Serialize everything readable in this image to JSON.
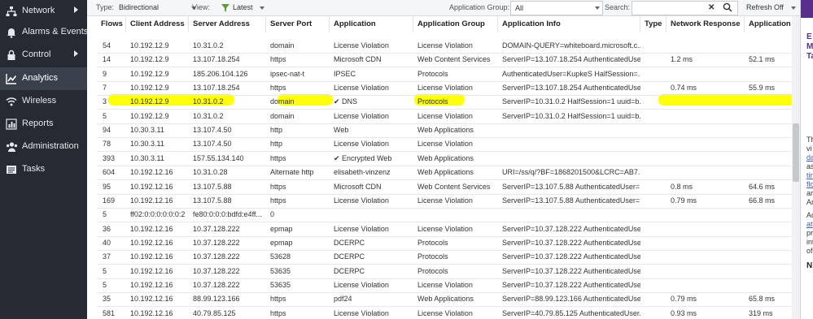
{
  "sidebar": {
    "items": [
      {
        "label": "Network",
        "icon": "network-icon",
        "has_chevron": true,
        "active": false
      },
      {
        "label": "Alarms & Events",
        "icon": "bell-icon",
        "has_chevron": false,
        "active": false
      },
      {
        "label": "Control",
        "icon": "lock-icon",
        "has_chevron": true,
        "active": false
      },
      {
        "label": "Analytics",
        "icon": "chart-line-icon",
        "has_chevron": false,
        "active": true
      },
      {
        "label": "Wireless",
        "icon": "wifi-icon",
        "has_chevron": false,
        "active": false
      },
      {
        "label": "Reports",
        "icon": "bar-chart-icon",
        "has_chevron": false,
        "active": false
      },
      {
        "label": "Administration",
        "icon": "users-icon",
        "has_chevron": false,
        "active": false
      },
      {
        "label": "Tasks",
        "icon": "tasks-icon",
        "has_chevron": false,
        "active": false
      }
    ]
  },
  "toolbar": {
    "type_label": "Type:",
    "type_value": "Bidirectional",
    "view_label": "View:",
    "view_value": "Latest",
    "app_group_label": "Application Group:",
    "app_group_value": "All",
    "search_label": "Search:",
    "search_value": "",
    "refresh_label": "Refresh Off"
  },
  "table": {
    "columns": [
      "Flows",
      "Client Address",
      "Server Address",
      "Server Port",
      "Application",
      "Application Group",
      "Application Info",
      "Type",
      "Network Response",
      "Application Resp"
    ],
    "partial_row": [
      "",
      "",
      "",
      "",
      "",
      "",
      "",
      "",
      "",
      ""
    ],
    "rows": [
      [
        "54",
        "10.192.12.9",
        "10.31.0.2",
        "domain",
        "License Violation",
        "License Violation",
        "DOMAIN-QUERY=whiteboard.microsoft.c...",
        "",
        "",
        ""
      ],
      [
        "14",
        "10.192.12.9",
        "13.107.18.254",
        "https",
        "Microsoft CDN",
        "Web Content Services",
        "ServerIP=13.107.18.254 AuthenticatedUse...",
        "",
        "1.2 ms",
        "52.1 ms"
      ],
      [
        "9",
        "10.192.12.9",
        "185.206.104.126",
        "ipsec-nat-t",
        "IPSEC",
        "Protocols",
        "AuthenticatedUser=KupkeS HalfSession=...",
        "",
        "",
        ""
      ],
      [
        "7",
        "10.192.12.9",
        "13.107.18.254",
        "https",
        "License Violation",
        "License Violation",
        "ServerIP=13.107.18.254 AuthenticatedUse...",
        "",
        "0.74 ms",
        "55.9 ms"
      ],
      [
        "3",
        "10.192.12.9",
        "10.31.0.2",
        "domain",
        "✔ DNS",
        "Protocols",
        "ServerIP=10.31.0.2 HalfSession=1 uuid=b...",
        "",
        "",
        ""
      ],
      [
        "5",
        "10.192.12.9",
        "10.31.0.2",
        "domain",
        "License Violation",
        "License Violation",
        "ServerIP=10.31.0.2 HalfSession=1 uuid=b...",
        "",
        "",
        ""
      ],
      [
        "94",
        "10.30.3.11",
        "13.107.4.50",
        "http",
        "Web",
        "Web Applications",
        "",
        "",
        "",
        ""
      ],
      [
        "78",
        "10.30.3.11",
        "13.107.4.50",
        "http",
        "License Violation",
        "License Violation",
        "",
        "",
        "",
        ""
      ],
      [
        "393",
        "10.30.3.11",
        "157.55.134.140",
        "https",
        "✔ Encrypted Web",
        "Web Applications",
        "",
        "",
        "",
        ""
      ],
      [
        "604",
        "10.192.12.16",
        "10.31.0.28",
        "Alternate http",
        "elisabeth-vinzenz",
        "Web Applications",
        "URI=/ss/q/?BF=1868201500&LCRC=AB7...",
        "",
        "",
        ""
      ],
      [
        "95",
        "10.192.12.16",
        "13.107.5.88",
        "https",
        "Microsoft CDN",
        "Web Content Services",
        "ServerIP=13.107.5.88 AuthenticatedUser=...",
        "",
        "0.8 ms",
        "64.6 ms"
      ],
      [
        "169",
        "10.192.12.16",
        "13.107.5.88",
        "https",
        "License Violation",
        "License Violation",
        "ServerIP=13.107.5.88 AuthenticatedUser=...",
        "",
        "0.79 ms",
        "66.8 ms"
      ],
      [
        "5",
        "ff02:0:0:0:0:0:0:2",
        "fe80:0:0:0:bdfd:e4ff...",
        "0",
        "",
        "",
        "",
        "",
        "",
        ""
      ],
      [
        "36",
        "10.192.12.16",
        "10.37.128.222",
        "epmap",
        "License Violation",
        "License Violation",
        "ServerIP=10.37.128.222 AuthenticatedUse...",
        "",
        "",
        ""
      ],
      [
        "40",
        "10.192.12.16",
        "10.37.128.222",
        "epmap",
        "DCERPC",
        "Protocols",
        "ServerIP=10.37.128.222 AuthenticatedUse...",
        "",
        "",
        ""
      ],
      [
        "37",
        "10.192.12.16",
        "10.37.128.222",
        "53628",
        "DCERPC",
        "Protocols",
        "ServerIP=10.37.128.222 AuthenticatedUse...",
        "",
        "",
        ""
      ],
      [
        "5",
        "10.192.12.16",
        "10.37.128.222",
        "53635",
        "DCERPC",
        "Protocols",
        "ServerIP=10.37.128.222 AuthenticatedUse...",
        "",
        "",
        ""
      ],
      [
        "5",
        "10.192.12.16",
        "10.37.128.222",
        "53635",
        "License Violation",
        "License Violation",
        "ServerIP=10.37.128.222 AuthenticatedUse...",
        "",
        "",
        ""
      ],
      [
        "35",
        "10.192.12.16",
        "88.99.123.166",
        "https",
        "pdf24",
        "Web Applications",
        "ServerIP=88.99.123.166 AuthenticatedUse...",
        "",
        "0.79 ms",
        "65.8 ms"
      ],
      [
        "581",
        "10.192.12.16",
        "40.79.85.125",
        "https",
        "License Violation",
        "License Violation",
        "ServerIP=40.79.85.125 AuthenticatedUser...",
        "",
        "0.93 ms",
        "319 ms"
      ]
    ]
  },
  "side_panel": {
    "header_letters": [
      "E",
      "M",
      "Ta"
    ],
    "text_lines": [
      "Th",
      "vi",
      "da",
      "as",
      "tin",
      "flo",
      "ar",
      "An",
      "Ac",
      "at",
      "pr",
      "int",
      "of",
      "N"
    ]
  },
  "colors": {
    "sidebar_bg": "#252a33",
    "sidebar_active": "#3b414c",
    "highlight": "#ffff00",
    "accent_purple": "#5a2e8c",
    "filter_green": "#5a9e3a"
  }
}
